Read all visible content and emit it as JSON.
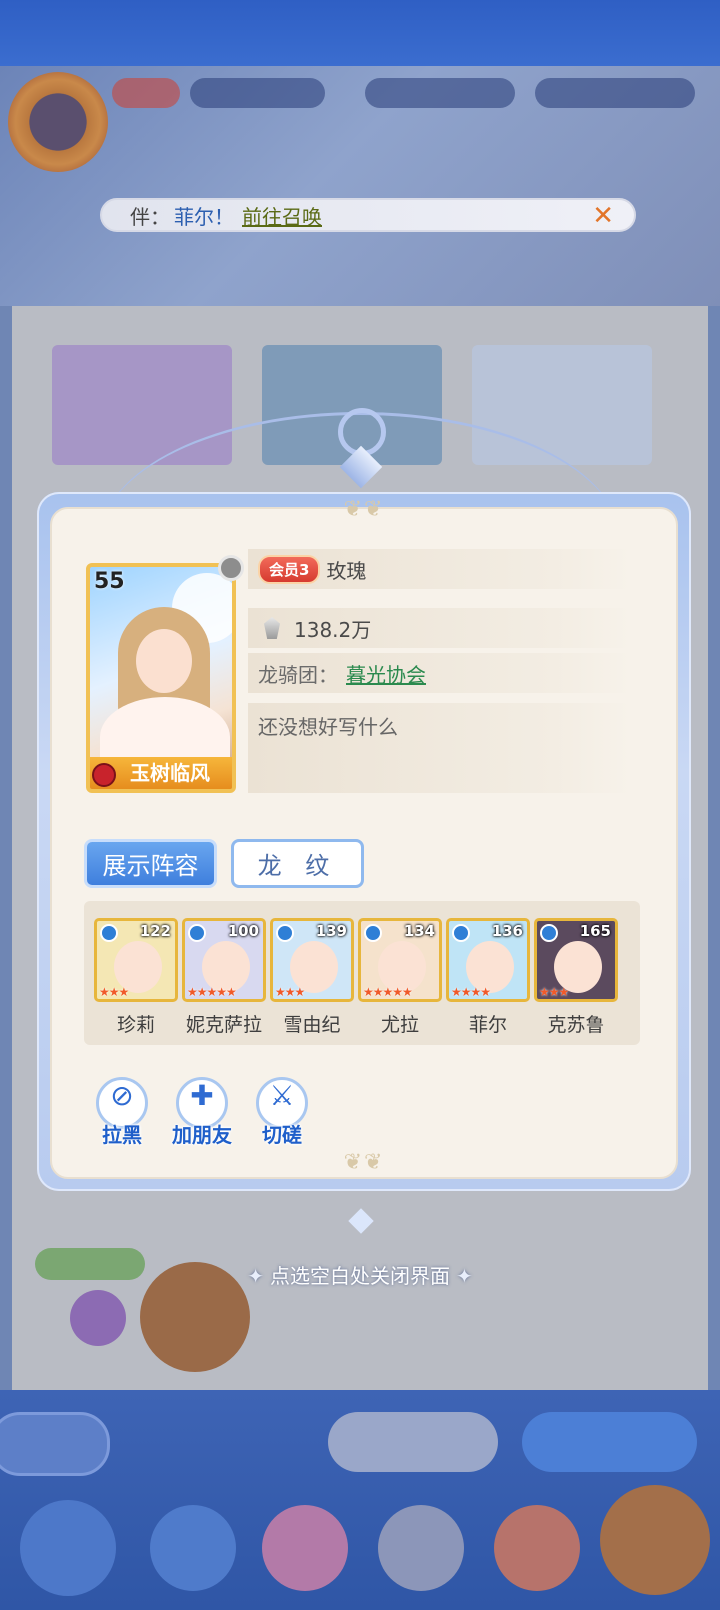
{
  "notice": {
    "prefix": "伴：",
    "name": "菲尔！",
    "link": "前往召唤",
    "close": "✕"
  },
  "profile": {
    "level": "55",
    "title_badge": "玉树临风",
    "vip": "会员3",
    "nickname": "玫瑰",
    "power": "138.2万",
    "guild_label": "龙骑团：",
    "guild_name": "暮光协会",
    "signature": "还没想好写什么"
  },
  "tabs": {
    "lineup": "展示阵容",
    "dragon_pattern": "龙 纹"
  },
  "heroes": [
    {
      "name": "珍莉",
      "level": "122",
      "stars": "★★★",
      "color": "#f4e7b4"
    },
    {
      "name": "妮克萨拉",
      "level": "100",
      "stars": "★★★★★",
      "color": "#d8d9f0"
    },
    {
      "name": "雪由纪",
      "level": "139",
      "stars": "★★★",
      "color": "#cfe6f7"
    },
    {
      "name": "尤拉",
      "level": "134",
      "stars": "★★★★★",
      "color": "#f5e2cc"
    },
    {
      "name": "菲尔",
      "level": "136",
      "stars": "★★★★",
      "color": "#bfe4f6"
    },
    {
      "name": "克苏鲁",
      "level": "165",
      "stars": "★★★",
      "color": "#5b4a5e"
    }
  ],
  "actions": {
    "block": "拉黑",
    "add_friend": "加朋友",
    "duel": "切磋"
  },
  "close_hint": "点选空白处关闭界面"
}
